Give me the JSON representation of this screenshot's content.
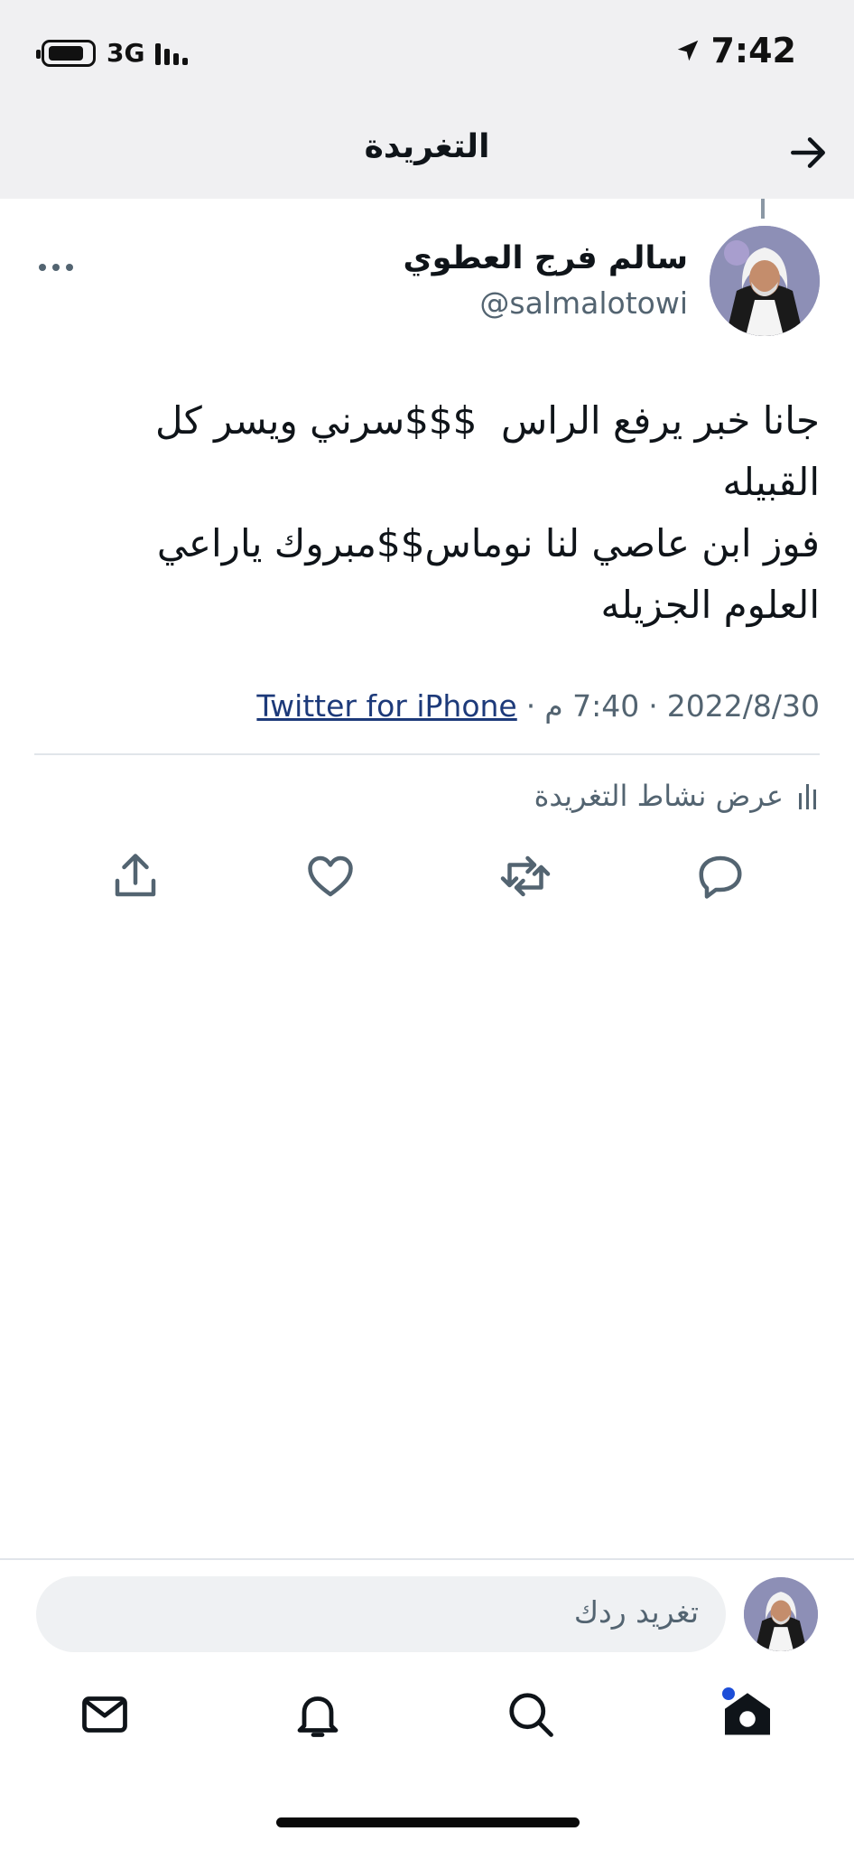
{
  "status_bar": {
    "network": "3G",
    "time": "7:42"
  },
  "header": {
    "title": "التغريدة"
  },
  "tweet": {
    "author_name": "سالم فرج العطوي",
    "author_handle": "@salmalotowi",
    "body_lines": [
      "جانا خبر يرفع الراس  $$$سرني ويسر كل",
      "القبيله",
      "فوز ابن عاصي لنا نوماس$$مبروك ياراعي",
      "العلوم الجزيله"
    ],
    "date": "2022/8/30",
    "time": "7:40 م",
    "separator": "·",
    "source": "Twitter for iPhone",
    "activity_label": "عرض نشاط التغريدة"
  },
  "reply": {
    "placeholder": "تغريد ردك"
  },
  "icons": {
    "status": [
      "battery-icon",
      "signal-icon",
      "location-icon"
    ],
    "header": [
      "back-arrow-icon"
    ],
    "tweet": [
      "more-icon",
      "activity-icon",
      "reply-icon",
      "retweet-icon",
      "like-icon",
      "share-icon"
    ],
    "tabbar": [
      "messages-icon",
      "notifications-icon",
      "search-icon",
      "home-icon"
    ]
  },
  "colors": {
    "link": "#1d3a7a",
    "secondary_text": "#536471",
    "notification_dot": "#1d4ed8"
  }
}
